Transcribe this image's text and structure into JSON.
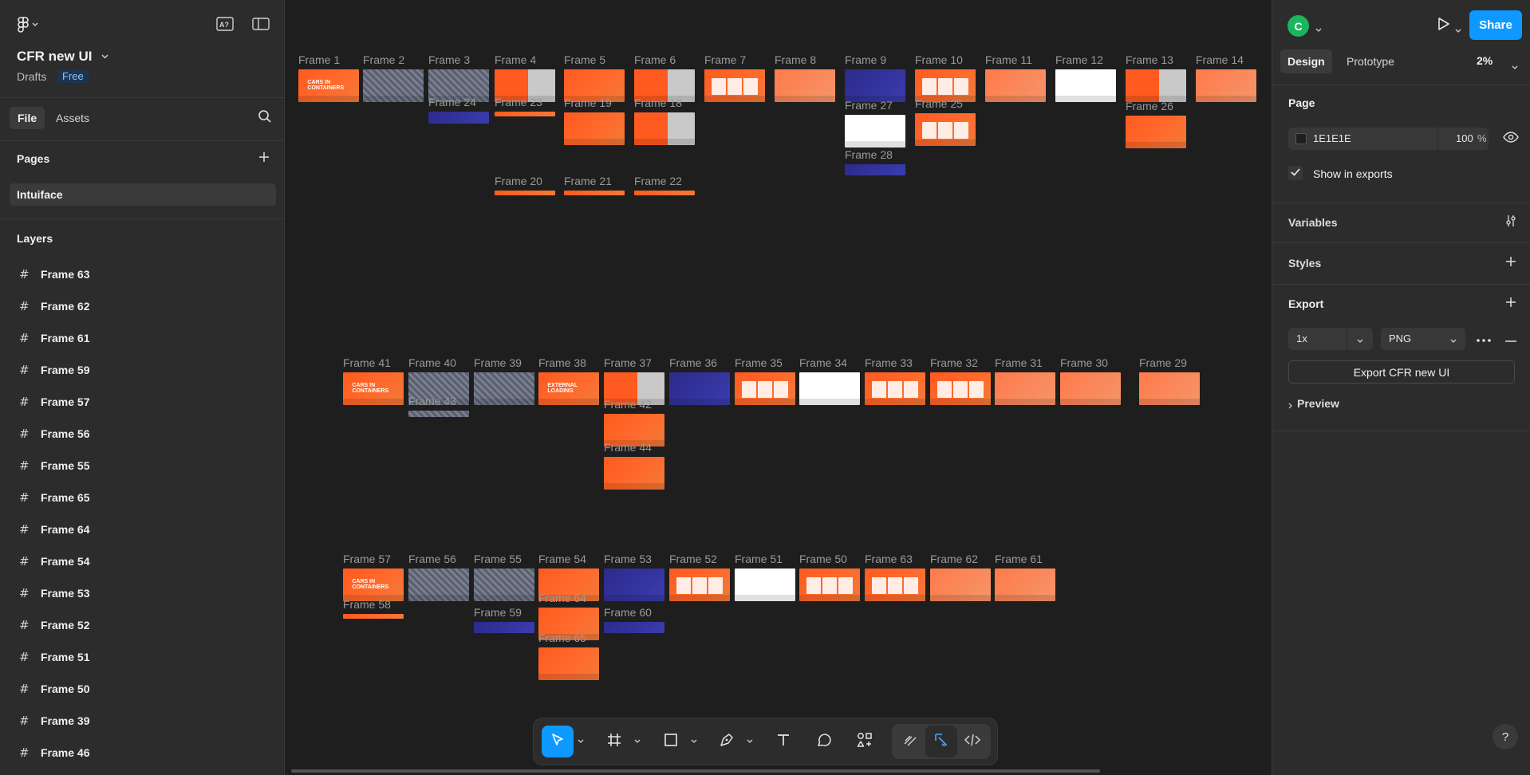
{
  "project": {
    "name": "CFR new UI",
    "location": "Drafts",
    "plan": "Free"
  },
  "left_tabs": {
    "file": "File",
    "assets": "Assets"
  },
  "pages": {
    "title": "Pages",
    "items": [
      "Intuiface"
    ]
  },
  "layers": {
    "title": "Layers",
    "items": [
      "Frame 63",
      "Frame 62",
      "Frame 61",
      "Frame 59",
      "Frame 57",
      "Frame 56",
      "Frame 55",
      "Frame 65",
      "Frame 64",
      "Frame 54",
      "Frame 53",
      "Frame 52",
      "Frame 51",
      "Frame 50",
      "Frame 39",
      "Frame 46"
    ]
  },
  "canvas": {
    "frames": [
      {
        "label": "Frame 1",
        "style": "orange",
        "text": "CARS IN CONTAINERS"
      },
      {
        "label": "Frame 2",
        "style": "grey"
      },
      {
        "label": "Frame 3",
        "style": "grey"
      },
      {
        "label": "Frame 4",
        "style": "mixed"
      },
      {
        "label": "Frame 5",
        "style": "orange"
      },
      {
        "label": "Frame 6",
        "style": "mixed"
      },
      {
        "label": "Frame 7",
        "style": "cards"
      },
      {
        "label": "Frame 8",
        "style": "light"
      },
      {
        "label": "Frame 9",
        "style": "blue"
      },
      {
        "label": "Frame 10",
        "style": "cards"
      },
      {
        "label": "Frame 11",
        "style": "light"
      },
      {
        "label": "Frame 12",
        "style": "white"
      },
      {
        "label": "Frame 13",
        "style": "mixed"
      },
      {
        "label": "Frame 14",
        "style": "light"
      },
      {
        "label": "Frame 24",
        "style": "blue"
      },
      {
        "label": "Frame 23",
        "style": "orange"
      },
      {
        "label": "Frame 19",
        "style": "orange"
      },
      {
        "label": "Frame 18",
        "style": "mixed"
      },
      {
        "label": "Frame 27",
        "style": "white"
      },
      {
        "label": "Frame 25",
        "style": "cards"
      },
      {
        "label": "Frame 26",
        "style": "orange"
      },
      {
        "label": "Frame 28",
        "style": "blue"
      },
      {
        "label": "Frame 20",
        "style": "orange"
      },
      {
        "label": "Frame 21",
        "style": "orange"
      },
      {
        "label": "Frame 22",
        "style": "orange"
      },
      {
        "label": "Frame 41",
        "style": "orange",
        "text": "CARS IN CONTAINERS"
      },
      {
        "label": "Frame 40",
        "style": "grey"
      },
      {
        "label": "Frame 39",
        "style": "grey"
      },
      {
        "label": "Frame 38",
        "style": "orange",
        "text": "EXTERNAL LOADING"
      },
      {
        "label": "Frame 37",
        "style": "mixed"
      },
      {
        "label": "Frame 36",
        "style": "blue"
      },
      {
        "label": "Frame 35",
        "style": "cards"
      },
      {
        "label": "Frame 34",
        "style": "white"
      },
      {
        "label": "Frame 33",
        "style": "cards"
      },
      {
        "label": "Frame 32",
        "style": "cards"
      },
      {
        "label": "Frame 31",
        "style": "light"
      },
      {
        "label": "Frame 30",
        "style": "light"
      },
      {
        "label": "Frame 29",
        "style": "light"
      },
      {
        "label": "Frame 43",
        "style": "grey"
      },
      {
        "label": "Frame 42",
        "style": "orange"
      },
      {
        "label": "Frame 44",
        "style": "orange"
      },
      {
        "label": "Frame 57",
        "style": "orange",
        "text": "CARS IN CONTAINERS"
      },
      {
        "label": "Frame 56",
        "style": "grey"
      },
      {
        "label": "Frame 55",
        "style": "grey"
      },
      {
        "label": "Frame 54",
        "style": "orange"
      },
      {
        "label": "Frame 53",
        "style": "blue"
      },
      {
        "label": "Frame 52",
        "style": "cards"
      },
      {
        "label": "Frame 51",
        "style": "white"
      },
      {
        "label": "Frame 50",
        "style": "cards"
      },
      {
        "label": "Frame 63",
        "style": "cards"
      },
      {
        "label": "Frame 62",
        "style": "light"
      },
      {
        "label": "Frame 61",
        "style": "light"
      },
      {
        "label": "Frame 58",
        "style": "orange"
      },
      {
        "label": "Frame 59",
        "style": "blue"
      },
      {
        "label": "Frame 60",
        "style": "blue"
      },
      {
        "label": "Frame 64",
        "style": "orange"
      },
      {
        "label": "Frame 65",
        "style": "orange"
      }
    ]
  },
  "right_panel": {
    "avatar_initial": "C",
    "share_label": "Share",
    "tabs": {
      "design": "Design",
      "prototype": "Prototype"
    },
    "zoom": "2%",
    "page": {
      "title": "Page",
      "color_hex": "1E1E1E",
      "opacity": "100",
      "opacity_unit": "%",
      "show_in_exports": "Show in exports"
    },
    "variables_title": "Variables",
    "styles_title": "Styles",
    "export": {
      "title": "Export",
      "scale": "1x",
      "format": "PNG",
      "button": "Export CFR new UI",
      "preview": "Preview"
    },
    "help": "?"
  },
  "colors": {
    "accent": "#0d99ff",
    "canvas_bg": "#1e1e1e",
    "panel_bg": "#2c2c2c",
    "frame_orange": "#ff5a1f",
    "frame_blue": "#2c2a8a",
    "avatar": "#1bb55c"
  }
}
